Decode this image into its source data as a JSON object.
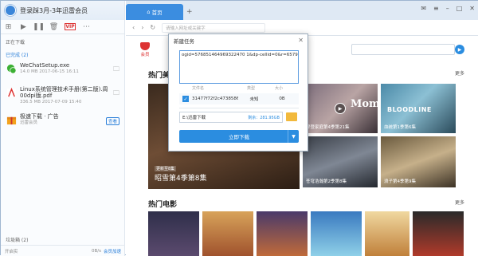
{
  "sidebar": {
    "user": "登录踩3月-3年迅雷会员",
    "section_downloading": "正在下载",
    "section_completed": "已完成 (2)",
    "items": [
      {
        "name": "WeChatSetup.exe",
        "meta": "14.0 MB   2017-06-15 16:11"
      },
      {
        "name": "Linux系统管理技术手册(第二版).周清3",
        "name2": "00dpi版.pdf",
        "meta": "336.5 MB   2017-07-09 15:40"
      },
      {
        "name": "极速下载 · 广告",
        "meta": "迅雷会员",
        "badge": "查看"
      }
    ],
    "trash": "垃圾箱 (2)",
    "status_left": "开启实",
    "speed": "0B/s",
    "vip": "会员加速"
  },
  "browser": {
    "tab": "首页",
    "url_placeholder": "请输入网址或关键字",
    "logo_label": "会员"
  },
  "main": {
    "sec1": "热门美剧",
    "sec2": "热门电影",
    "more": "更多",
    "big_caption": "昭雪第4季第8集",
    "big_label": "更新至8集",
    "thumbs": [
      {
        "caption": "摩登家庭第4季第21集",
        "label": "更新至21集"
      },
      {
        "caption": "血统第1季第6集",
        "label": "更新至6集"
      },
      {
        "caption": "苍穹浩瀚第2季第8集",
        "label": "更新至8集"
      },
      {
        "caption": "浪子第4季第9集",
        "label": "更新至9集"
      }
    ],
    "mom_text": "Mom",
    "bloodline_text": "BLOODLINE"
  },
  "dialog": {
    "title": "新建任务",
    "link": "ogid=576851464969322470 1&dp-cellid=0&r=657923268",
    "col_name": "文件名",
    "col_type": "类型",
    "col_size": "大小",
    "file_name": "31477f72f2c4738586​7...",
    "file_type": "未知",
    "file_size": "0B",
    "path": "E:\\迅雷下载",
    "free": "剩余：281.95GB",
    "download_btn": "立即下载"
  }
}
